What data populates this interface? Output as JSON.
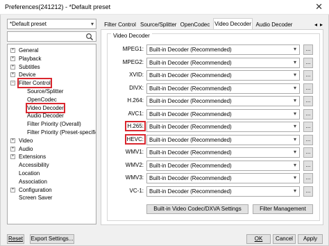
{
  "window": {
    "title": "Preferences(241212) - *Default preset",
    "close_glyph": "✕"
  },
  "left": {
    "preset_value": "*Default preset",
    "search_placeholder": "",
    "tree": [
      {
        "label": "General",
        "exp": "+",
        "level": 0
      },
      {
        "label": "Playback",
        "exp": "+",
        "level": 0
      },
      {
        "label": "Subtitles",
        "exp": "+",
        "level": 0
      },
      {
        "label": "Device",
        "exp": "+",
        "level": 0
      },
      {
        "label": "Filter Control",
        "exp": "−",
        "level": 0,
        "highlight": true
      },
      {
        "label": "Source/Splitter",
        "level": 1
      },
      {
        "label": "OpenCodec",
        "level": 1
      },
      {
        "label": "Video Decoder",
        "level": 1,
        "highlight": true
      },
      {
        "label": "Audio Decoder",
        "level": 1
      },
      {
        "label": "Filter Priority (Overall)",
        "level": 1
      },
      {
        "label": "Filter Priority (Preset-specific)",
        "level": 1
      },
      {
        "label": "Video",
        "exp": "+",
        "level": 0
      },
      {
        "label": "Audio",
        "exp": "+",
        "level": 0
      },
      {
        "label": "Extensions",
        "exp": "+",
        "level": 0
      },
      {
        "label": "Accessibility",
        "level": 0
      },
      {
        "label": "Location",
        "level": 0
      },
      {
        "label": "Association",
        "level": 0
      },
      {
        "label": "Configuration",
        "exp": "+",
        "level": 0
      },
      {
        "label": "Screen Saver",
        "level": 0
      }
    ]
  },
  "tabs": [
    "Filter Control",
    "Source/Splitter",
    "OpenCodec",
    "Video Decoder",
    "Audio Decoder"
  ],
  "active_tab": "Video Decoder",
  "group_title": "Video Decoder",
  "codecs": [
    {
      "label": "MPEG1:",
      "value": "Built-in Decoder (Recommended)"
    },
    {
      "label": "MPEG2:",
      "value": "Built-in Decoder (Recommended)"
    },
    {
      "label": "XVID:",
      "value": "Built-in Decoder (Recommended)"
    },
    {
      "label": "DIVX:",
      "value": "Built-in Decoder (Recommended)"
    },
    {
      "label": "H.264:",
      "value": "Built-in Decoder (Recommended)"
    },
    {
      "label": "AVC1:",
      "value": "Built-in Decoder (Recommended)"
    },
    {
      "label": "H.265:",
      "value": "Built-in Decoder (Recommended)",
      "highlight": true
    },
    {
      "label": "HEVC:",
      "value": "Built-in Decoder (Recommended)",
      "highlight": true
    },
    {
      "label": "WMV1:",
      "value": "Built-in Decoder (Recommended)"
    },
    {
      "label": "WMV2:",
      "value": "Built-in Decoder (Recommended)"
    },
    {
      "label": "WMV3:",
      "value": "Built-in Decoder (Recommended)"
    },
    {
      "label": "VC-1:",
      "value": "Built-in Decoder (Recommended)"
    }
  ],
  "dots_label": "...",
  "builtin_button": "Built-in Video Codec/DXVA Settings",
  "filter_mgmt_button": "Filter Management",
  "bottom": {
    "reset": "Reset",
    "export": "Export Settings...",
    "ok": "OK",
    "cancel": "Cancel",
    "apply": "Apply"
  },
  "colors": {
    "highlight": "#d9262e",
    "window_bg": "#f0f0f0"
  }
}
